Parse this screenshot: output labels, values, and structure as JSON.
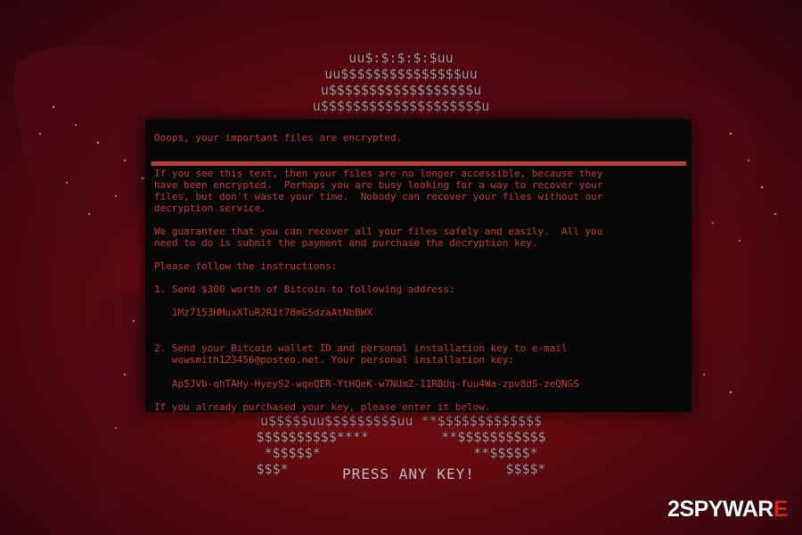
{
  "ascii_art": {
    "top": "uu$:$:$:$:$uu\nuu$$$$$$$$$$$$$$$uu\nu$$$$$$$$$$$$$$$$$$u\nu$$$$$$$$$$$$$$$$$$$$u",
    "bottom": "u$$$$$uu$$$$$$$$$uu **$$$$$$$$$$$$$\n$$$$$$$$$$****         **$$$$$$$$$$$\n*$$$$$*                   **$$$$$*\n$$$*                           $$$$*"
  },
  "press_key": "PRESS ANY KEY!",
  "terminal": {
    "header": "Ooops, your important files are encrypted.",
    "paragraph1": "If you see this text, then your files are no longer accessible, because they\nhave been encrypted.  Perhaps you are busy looking for a way to recover your\nfiles, but don't waste your time.  Nobody can recover your files without our\ndecryption service.",
    "paragraph2": "We guarantee that you can recover all your files safely and easily.  All you\nneed to do is submit the payment and purchase the decryption key.",
    "instructions": "Please follow the instructions:",
    "step1": "1. Send $300 worth of Bitcoin to following address:",
    "address": "   1Mz7153HMuxXTuR2R1t78mGSdzaAtNbBWX",
    "step2": "2. Send your Bitcoin wallet ID and personal installation key to e-mail\n   wowsmith123456@posteo.net. Your personal installation key:",
    "install_key": "   Ap5JVb-qhTAHy-HyeyS2-wqeQER-YtHQeK-w7NUmZ-11RBUq-fuu4Wa-zpv8dS-zeQNGS",
    "footer": "If you already purchased your key, please enter it below."
  },
  "logo": {
    "prefix": "2SPYWAR",
    "suffix": "E"
  },
  "colors": {
    "terminal_text": "#c23a34",
    "terminal_bg": "#070707",
    "background": "#7a0b12",
    "logo_accent": "#e21d1d"
  }
}
